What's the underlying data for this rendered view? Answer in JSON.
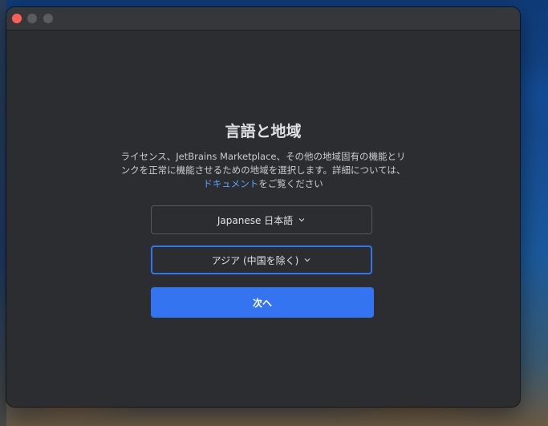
{
  "window": {
    "controls": [
      "close",
      "minimize",
      "maximize"
    ]
  },
  "main": {
    "title": "言語と地域",
    "description_prefix": "ライセンス、JetBrains Marketplace、その他の地域固有の機能とリンクを正常に機能させるための地域を選択します。詳細については、",
    "description_link": "ドキュメント",
    "description_suffix": "をご覧ください"
  },
  "language_select": {
    "value": "Japanese 日本語",
    "icon": "chevron-down-icon"
  },
  "region_select": {
    "value": "アジア (中国を除く)",
    "icon": "chevron-down-icon"
  },
  "next_button": {
    "label": "次へ"
  },
  "colors": {
    "accent": "#3574f0",
    "link": "#5aa0ff",
    "window_bg": "#2b2d30",
    "close": "#ff5f57"
  }
}
